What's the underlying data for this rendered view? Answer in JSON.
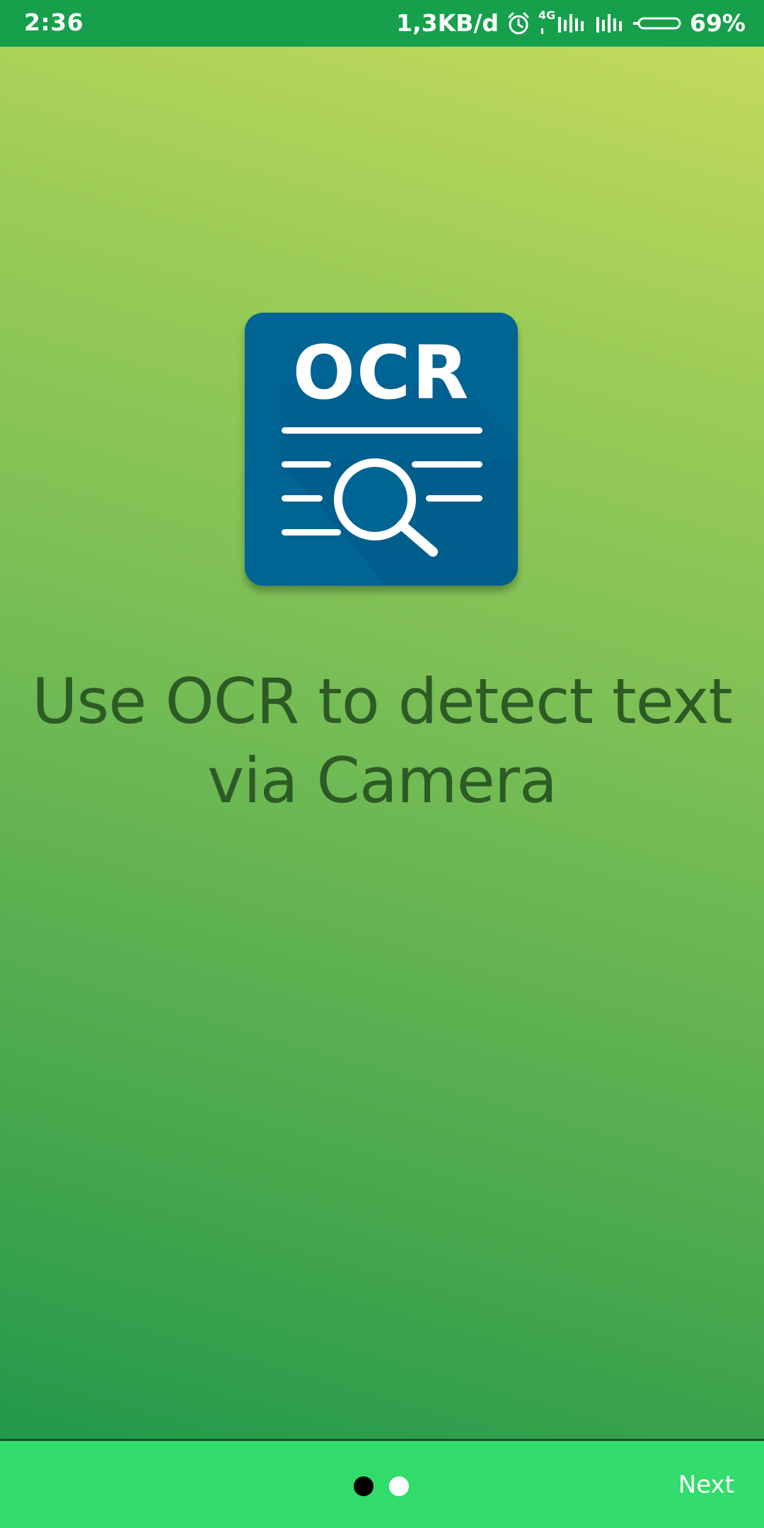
{
  "status_bar": {
    "time": "2:36",
    "network_speed": "1,3KB/d",
    "network_type": "4G",
    "battery_percent": "69%",
    "icons": [
      "alarm-icon",
      "signal-icon",
      "signal-icon-2",
      "battery-icon"
    ],
    "background_color": "#16a04c"
  },
  "onboarding": {
    "logo_text": "OCR",
    "headline": "Use OCR to detect text via Camera",
    "logo_color": "#006494",
    "headline_color": "#2d5a25"
  },
  "pager": {
    "total_pages": 2,
    "current_page": 1
  },
  "bottom_bar": {
    "next_label": "Next",
    "background_color": "#32dc6a"
  }
}
